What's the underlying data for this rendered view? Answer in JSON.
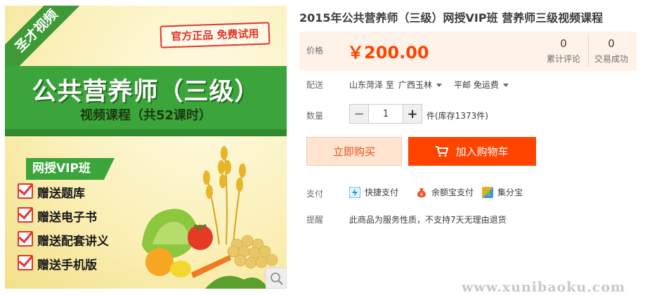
{
  "product": {
    "title": "2015年公共营养师（三级）网授VIP班 营养师三级视频课程",
    "image": {
      "corner_ribbon": "圣才视频",
      "official_stamp": "官方正品 免费试用",
      "main_title": "公共营养师（三级）",
      "sub_title": "视频课程（共52课时）",
      "vip_banner": "网授VIP班",
      "perks": [
        "赠送题库",
        "赠送电子书",
        "赠送配套讲义",
        "赠送手机版"
      ]
    }
  },
  "price": {
    "label": "价格",
    "value": "￥200.00",
    "stats": [
      {
        "count": "0",
        "label": "累计评论"
      },
      {
        "count": "0",
        "label": "交易成功"
      }
    ]
  },
  "shipping": {
    "label": "配送",
    "origin": "山东菏泽 至",
    "destination": "广西玉林",
    "method": "平邮 免运费"
  },
  "quantity": {
    "label": "数量",
    "value": "1",
    "unit_text": "件(库存1373件)",
    "minus": "−",
    "plus": "+"
  },
  "buttons": {
    "buy_now": "立即购买",
    "add_to_cart": "加入购物车"
  },
  "payment": {
    "label": "支付",
    "methods": [
      {
        "name": "快捷支付",
        "icon": "lightning-icon",
        "color": "#1e9be8"
      },
      {
        "name": "余额宝支付",
        "icon": "moneybag-icon",
        "color": "#f0502c"
      },
      {
        "name": "集分宝",
        "icon": "colorful-square-icon",
        "color": "#f5a623"
      }
    ]
  },
  "reminder": {
    "label": "提醒",
    "text": "此商品为服务性质，不支持7天无理由退货"
  },
  "watermark": "www.xunibaoku.com",
  "colors": {
    "accent": "#ff4400",
    "price": "#ff4400",
    "price_bg": "#fff2e8",
    "brand_green": "#3ba43a"
  }
}
